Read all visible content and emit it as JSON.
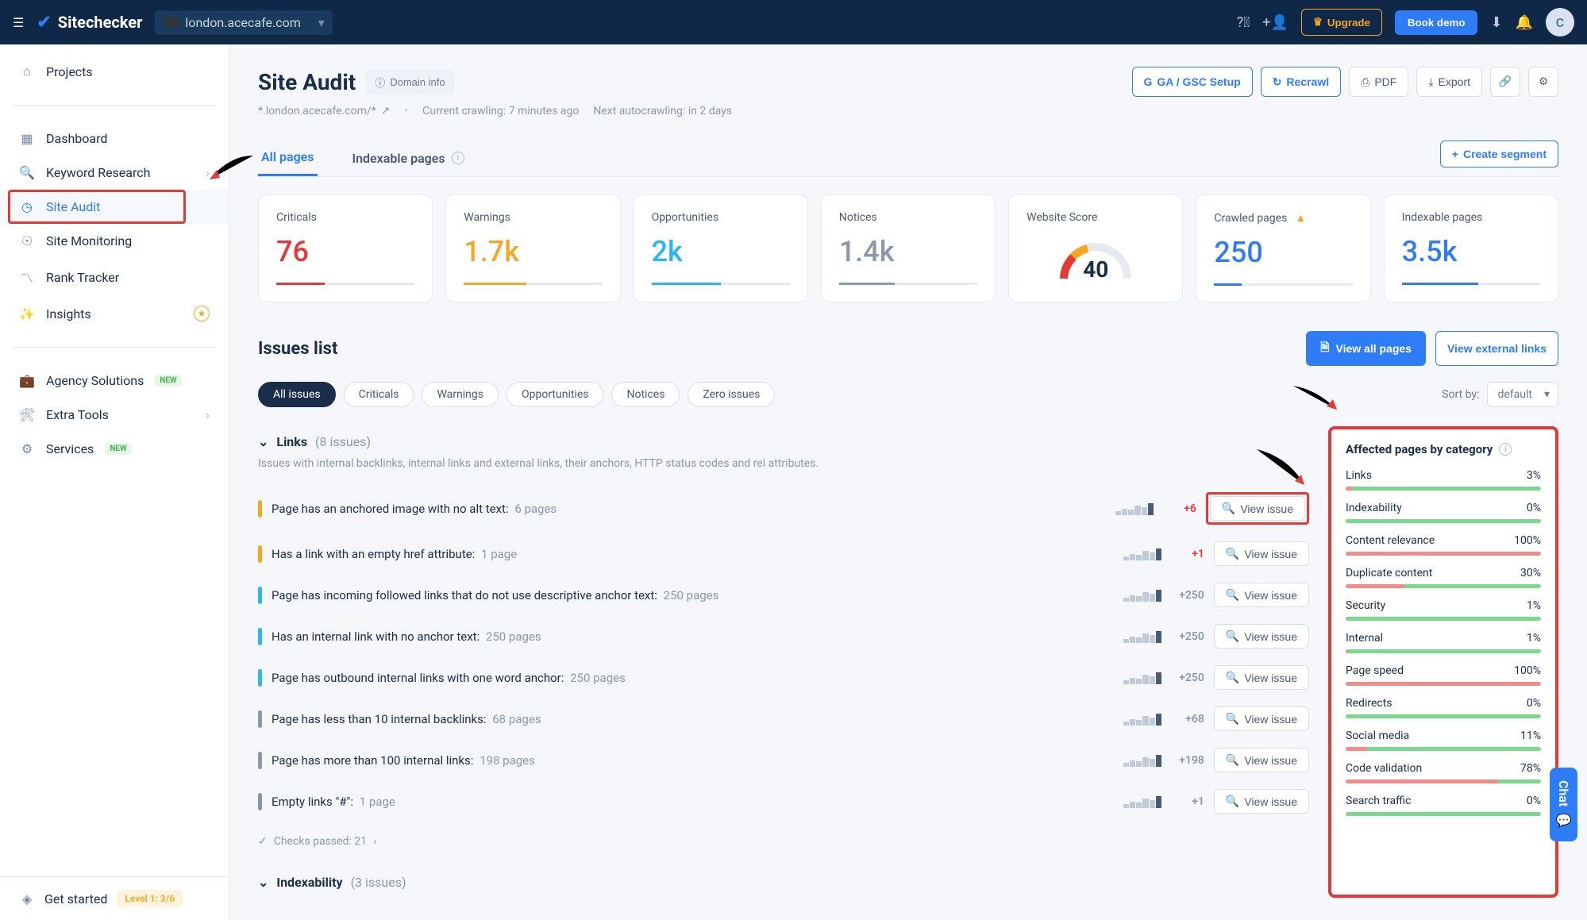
{
  "brand": "Sitechecker",
  "domain_selector": "london.acecafe.com",
  "topnav": {
    "upgrade": "Upgrade",
    "book_demo": "Book demo",
    "avatar_initial": "C"
  },
  "sidebar": {
    "projects": "Projects",
    "dashboard": "Dashboard",
    "keyword_research": "Keyword Research",
    "site_audit": "Site Audit",
    "site_monitoring": "Site Monitoring",
    "rank_tracker": "Rank Tracker",
    "insights": "Insights",
    "agency_solutions": "Agency Solutions",
    "extra_tools": "Extra Tools",
    "services": "Services",
    "new_badge": "NEW",
    "get_started": "Get started",
    "level": "Level 1: 3/6"
  },
  "page": {
    "title": "Site Audit",
    "domain_info": "Domain info",
    "domain_text": "*.london.acecafe.com/*",
    "crawling": "Current crawling: 7 minutes ago",
    "next_crawl": "Next autocrawling: in 2 days"
  },
  "header_actions": {
    "ga_gsc": "GA / GSC Setup",
    "recrawl": "Recrawl",
    "pdf": "PDF",
    "export": "Export"
  },
  "tabs": {
    "all_pages": "All pages",
    "indexable": "Indexable pages",
    "create_segment": "Create segment"
  },
  "stats": {
    "criticals": {
      "label": "Criticals",
      "value": "76",
      "color": "#e53935",
      "fill": 35
    },
    "warnings": {
      "label": "Warnings",
      "value": "1.7k",
      "color": "#f5a623",
      "fill": 45
    },
    "opportunities": {
      "label": "Opportunities",
      "value": "2k",
      "color": "#29b6f6",
      "fill": 50
    },
    "notices": {
      "label": "Notices",
      "value": "1.4k",
      "color": "#8a98ac",
      "fill": 40
    },
    "website_score": {
      "label": "Website Score",
      "value": "40"
    },
    "crawled": {
      "label": "Crawled pages",
      "value": "250",
      "fill": 20
    },
    "indexable": {
      "label": "Indexable pages",
      "value": "3.5k",
      "fill": 55
    }
  },
  "issues": {
    "title": "Issues list",
    "view_all": "View all pages",
    "view_external": "View external links",
    "sort_label": "Sort by:",
    "sort_value": "default",
    "filters": {
      "all": "All issues",
      "criticals": "Criticals",
      "warnings": "Warnings",
      "opportunities": "Opportunities",
      "notices": "Notices",
      "zero": "Zero issues"
    },
    "group_links": {
      "name": "Links",
      "count": "(8 issues)",
      "desc": "Issues with internal backlinks, internal links and external links, their anchors, HTTP status codes and rel attributes."
    },
    "view_issue": "View issue",
    "rows": [
      {
        "sev": "#f5a623",
        "text": "Page has an anchored image with no alt text:",
        "pages": "6 pages",
        "delta": "+6",
        "deltaClass": "red"
      },
      {
        "sev": "#f5a623",
        "text": "Has a link with an empty href attribute:",
        "pages": "1 page",
        "delta": "+1",
        "deltaClass": "red"
      },
      {
        "sev": "#29b6f6",
        "text": "Page has incoming followed links that do not use descriptive anchor text:",
        "pages": "250 pages",
        "delta": "+250",
        "deltaClass": "gray"
      },
      {
        "sev": "#29b6f6",
        "text": "Has an internal link with no anchor text:",
        "pages": "250 pages",
        "delta": "+250",
        "deltaClass": "gray"
      },
      {
        "sev": "#29b6f6",
        "text": "Page has outbound internal links with one word anchor:",
        "pages": "250 pages",
        "delta": "+250",
        "deltaClass": "gray"
      },
      {
        "sev": "#8a98ac",
        "text": "Page has less than 10 internal backlinks:",
        "pages": "68 pages",
        "delta": "+68",
        "deltaClass": "gray"
      },
      {
        "sev": "#8a98ac",
        "text": "Page has more than 100 internal links:",
        "pages": "198 pages",
        "delta": "+198",
        "deltaClass": "gray"
      },
      {
        "sev": "#8a98ac",
        "text": "Empty links \"#\":",
        "pages": "1 page",
        "delta": "+1",
        "deltaClass": "gray"
      }
    ],
    "checks_passed": "Checks passed: 21",
    "group_indexability": {
      "name": "Indexability",
      "count": "(3 issues)"
    }
  },
  "affected": {
    "title": "Affected pages by category",
    "cats": [
      {
        "name": "Links",
        "pct": "3%",
        "red": 3
      },
      {
        "name": "Indexability",
        "pct": "0%",
        "red": 0
      },
      {
        "name": "Content relevance",
        "pct": "100%",
        "red": 100
      },
      {
        "name": "Duplicate content",
        "pct": "30%",
        "red": 30
      },
      {
        "name": "Security",
        "pct": "1%",
        "red": 1
      },
      {
        "name": "Internal",
        "pct": "1%",
        "red": 1
      },
      {
        "name": "Page speed",
        "pct": "100%",
        "red": 100
      },
      {
        "name": "Redirects",
        "pct": "0%",
        "red": 0
      },
      {
        "name": "Social media",
        "pct": "11%",
        "red": 11
      },
      {
        "name": "Code validation",
        "pct": "78%",
        "red": 78
      },
      {
        "name": "Search traffic",
        "pct": "0%",
        "red": 0
      }
    ]
  },
  "chat": "Chat"
}
